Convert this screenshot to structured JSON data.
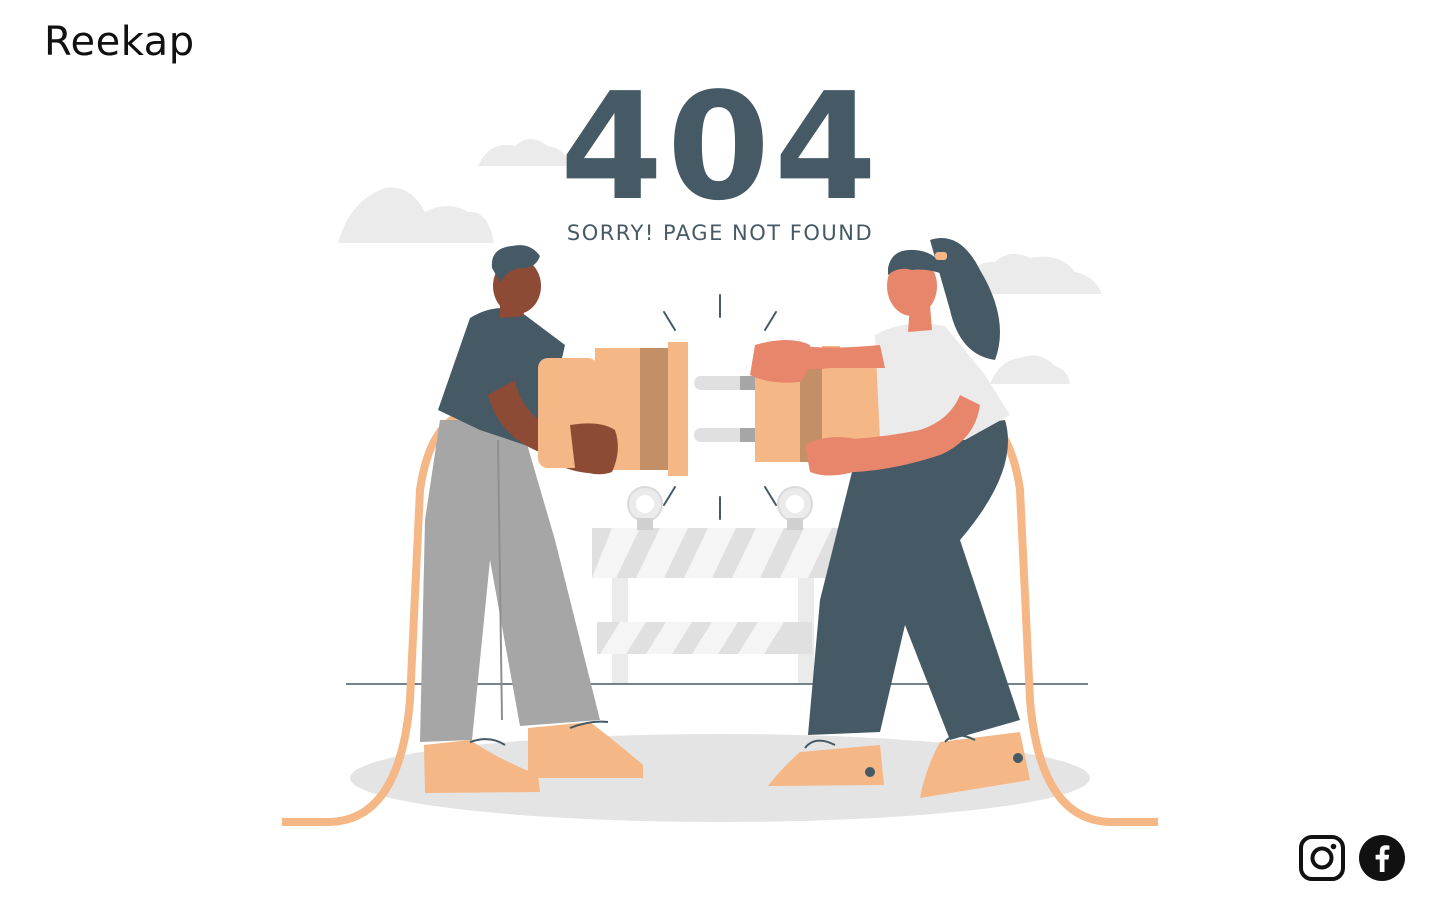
{
  "brand": {
    "logo_text": "Reekap"
  },
  "error": {
    "code": "404",
    "message": "SORRY! PAGE NOT FOUND"
  },
  "social": {
    "items": [
      {
        "name": "instagram-icon"
      },
      {
        "name": "facebook-icon"
      }
    ]
  },
  "colors": {
    "ink": "#455a64",
    "skin_orange": "#f4b785",
    "plug_dark": "#c38f66",
    "gray_light": "#e0e0e0",
    "pants_gray": "#a6a6a6",
    "man_skin": "#8d4b35",
    "woman_skin": "#e8866b"
  }
}
